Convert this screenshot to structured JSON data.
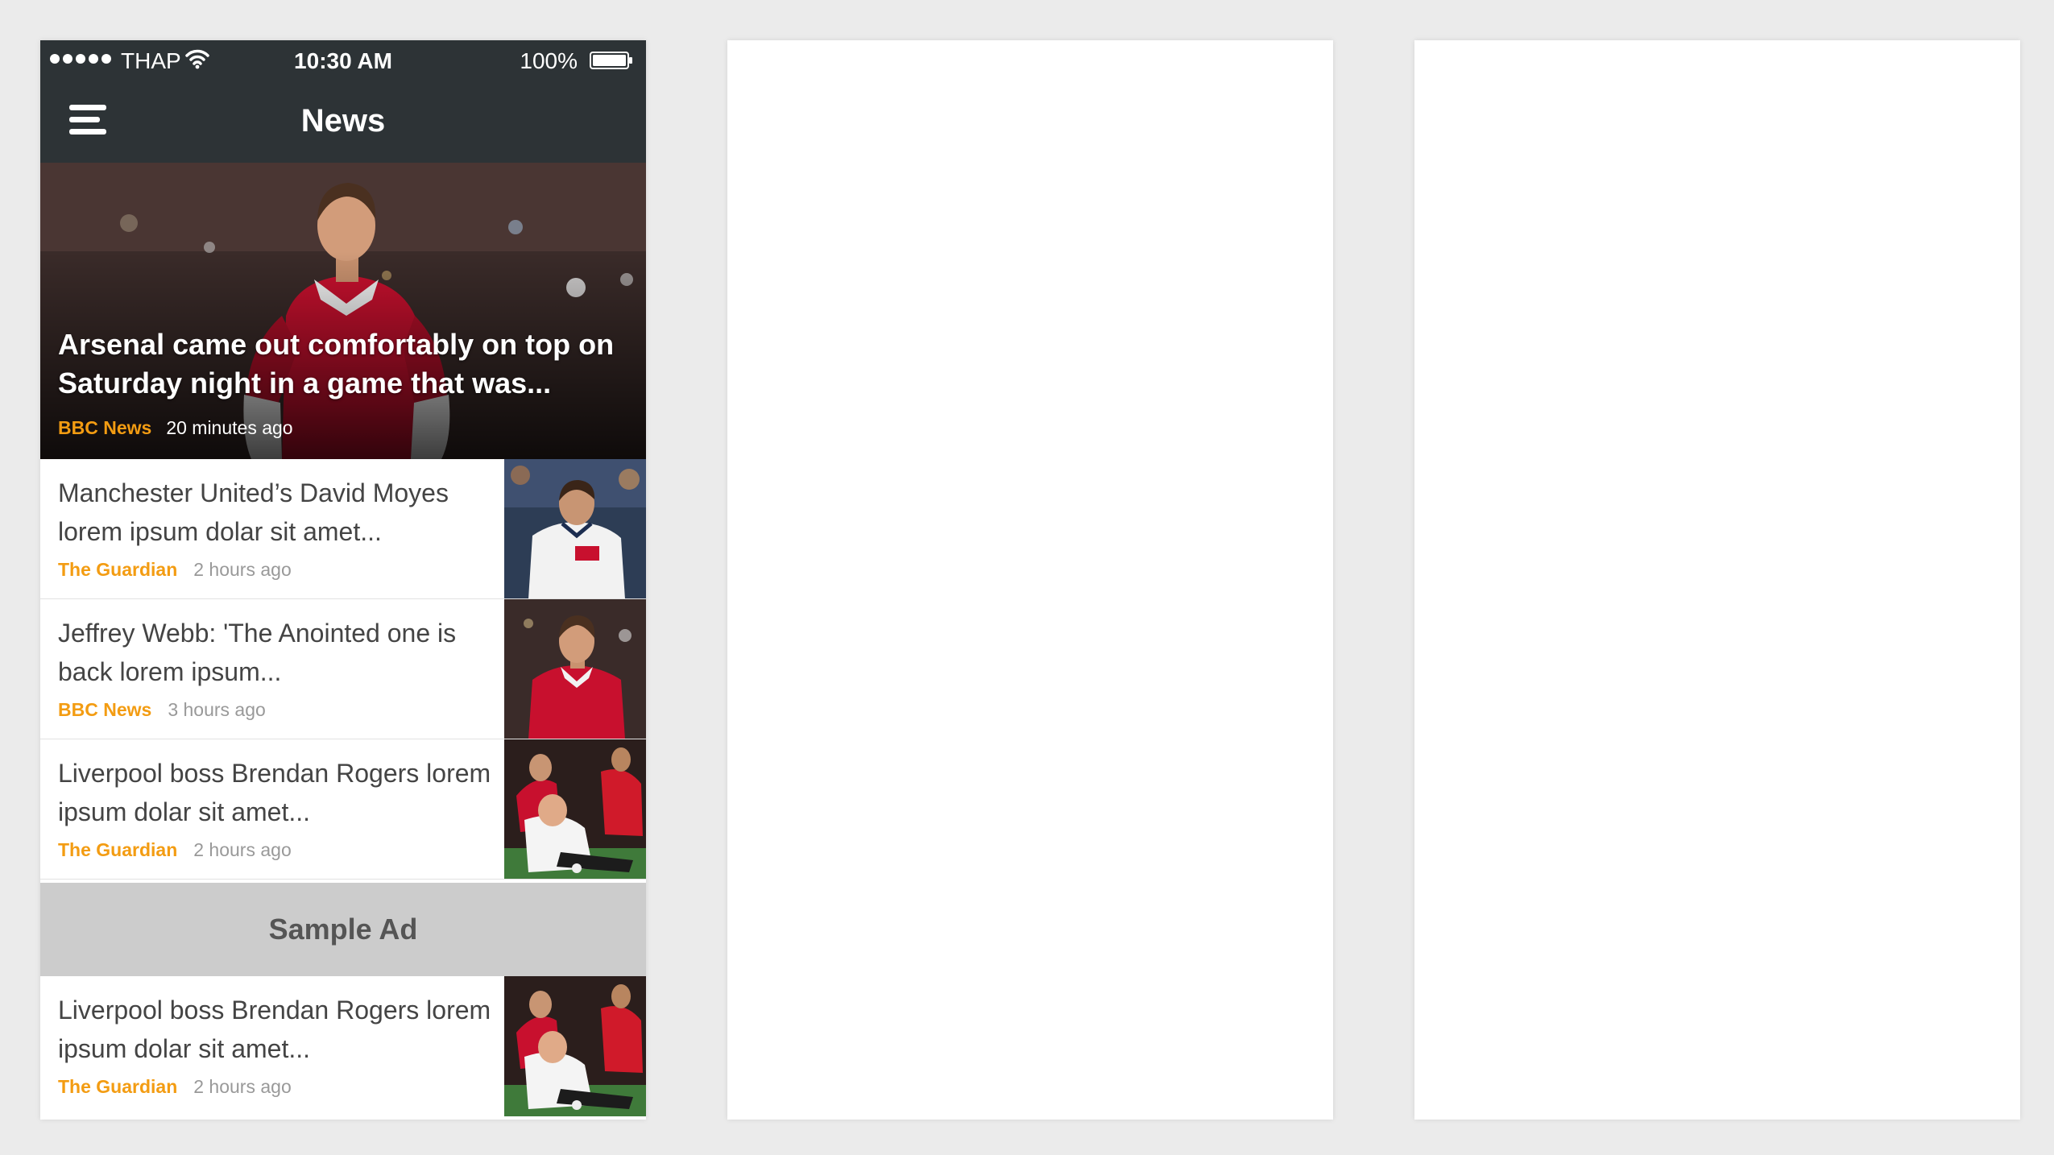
{
  "status_bar": {
    "carrier": "THAP",
    "time": "10:30 AM",
    "battery": "100%"
  },
  "nav": {
    "title": "News"
  },
  "hero": {
    "headline": "Arsenal came out comfortably on top on Saturday night in a game that was...",
    "source": "BBC News",
    "time_ago": "20 minutes ago"
  },
  "articles": [
    {
      "title": "Manchester United’s David Moyes lorem ipsum dolar sit amet...",
      "source": "The Guardian",
      "time_ago": "2 hours ago"
    },
    {
      "title": "Jeffrey Webb: 'The Anointed one is back lorem ipsum...",
      "source": "BBC News",
      "time_ago": "3 hours ago"
    },
    {
      "title": "Liverpool boss Brendan Rogers lorem ipsum dolar sit amet...",
      "source": "The Guardian",
      "time_ago": "2 hours ago"
    },
    {
      "title": "Liverpool boss Brendan Rogers lorem ipsum dolar sit amet...",
      "source": "The Guardian",
      "time_ago": "2 hours ago"
    }
  ],
  "ad": {
    "label": "Sample Ad"
  },
  "colors": {
    "bar_background": "#2d3336",
    "source_accent": "#f39c12",
    "ad_background": "#cccccc"
  },
  "icons": [
    "signal-dots-icon",
    "wifi-icon",
    "battery-icon",
    "hamburger-menu-icon"
  ]
}
